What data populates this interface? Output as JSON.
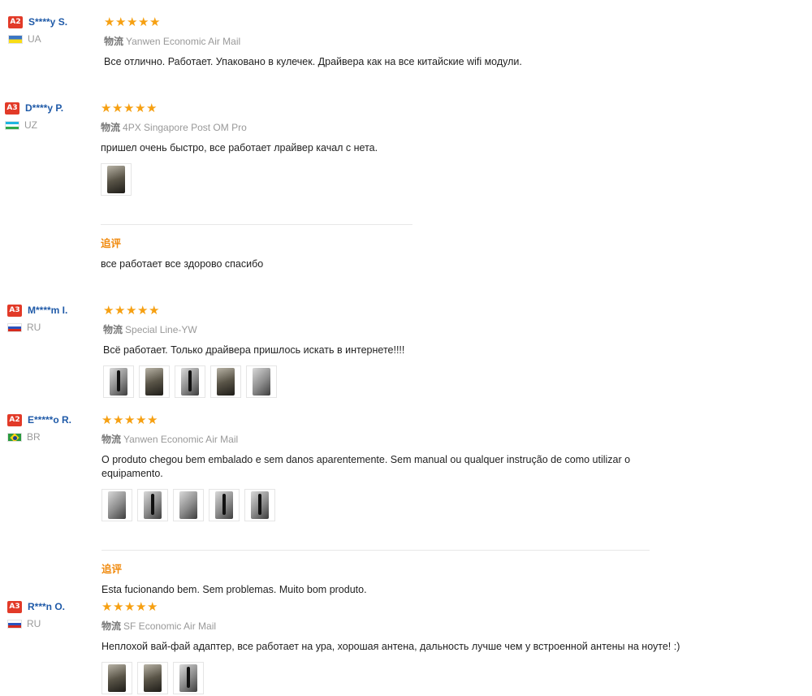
{
  "logistics_key": "物流",
  "append_label": "追评",
  "reviews": [
    {
      "badge": "A2",
      "name": "S****y S.",
      "country": "UA",
      "shipping": "Yanwen Economic Air Mail",
      "text": "Все отлично. Работает. Упаковано в кулечек. Драйвера как на все китайские wifi модули.",
      "stars": 5
    },
    {
      "badge": "A3",
      "name": "D****y P.",
      "country": "UZ",
      "shipping": "4PX Singapore Post OM Pro",
      "text": "пришел очень быстро, все работает лрайвер качал с нета.",
      "stars": 5,
      "followup": "все работает все здорово спасибо"
    },
    {
      "badge": "A3",
      "name": "M****m I.",
      "country": "RU",
      "shipping": "Special Line-YW",
      "text": "Всё работает. Только драйвера пришлось искать в интернете!!!!",
      "stars": 5
    },
    {
      "badge": "A2",
      "name": "E*****o R.",
      "country": "BR",
      "shipping": "Yanwen Economic Air Mail",
      "text": "O produto chegou bem embalado e sem danos aparentemente. Sem manual ou qualquer instrução de como utilizar o equipamento.",
      "stars": 5,
      "followup": "Esta fucionando bem. Sem problemas. Muito bom produto."
    },
    {
      "badge": "A3",
      "name": "R***n O.",
      "country": "RU",
      "shipping": "SF Economic Air Mail",
      "text": "Неплохой вай-фай адаптер, все работает на ура, хорошая антена, дальность лучше чем у встроенной антены на ноуте! :)",
      "stars": 5
    }
  ],
  "colors": {
    "badge": "#e23a28",
    "username": "#1f5aa8",
    "star": "#f6a012",
    "append_label": "#f08a0e"
  }
}
